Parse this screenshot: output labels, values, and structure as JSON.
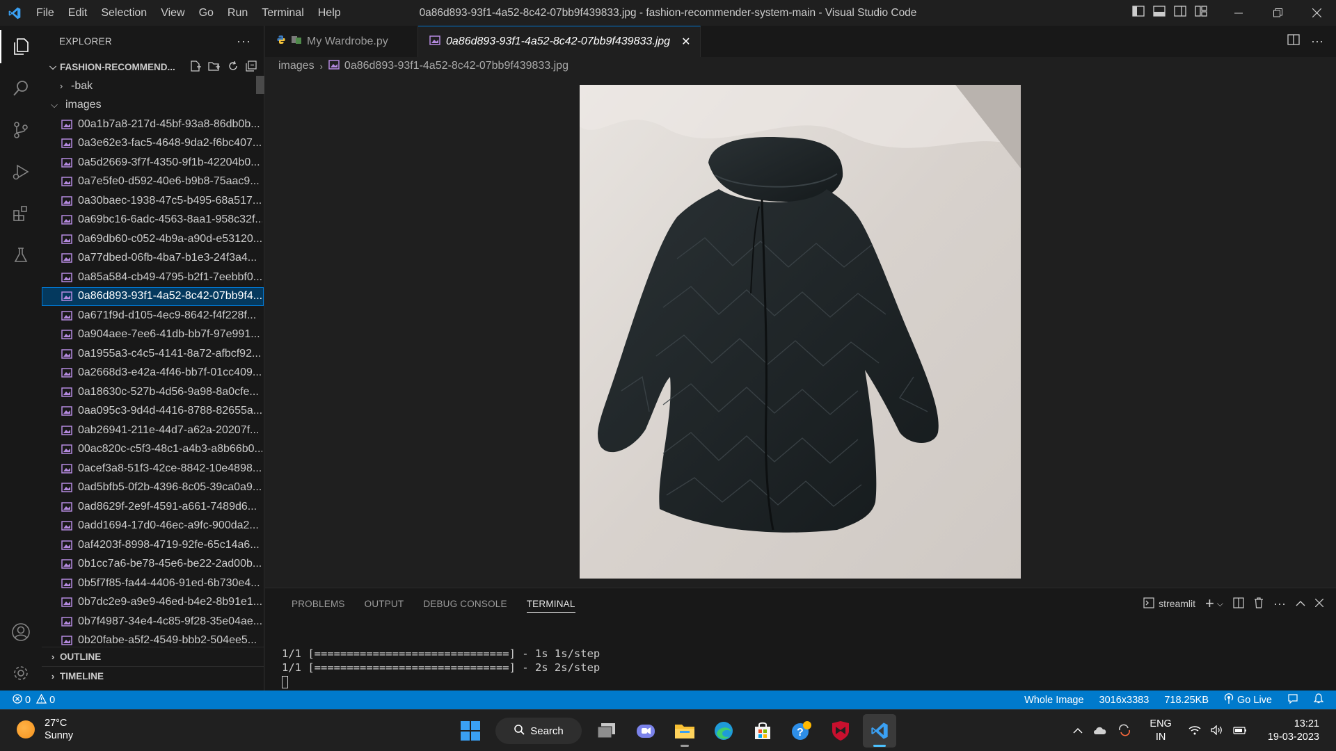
{
  "titlebar": {
    "menu": [
      "File",
      "Edit",
      "Selection",
      "View",
      "Go",
      "Run",
      "Terminal",
      "Help"
    ],
    "window_title": "0a86d893-93f1-4a52-8c42-07bb9f439833.jpg - fashion-recommender-system-main - Visual Studio Code"
  },
  "sidebar": {
    "title": "EXPLORER",
    "more": "···",
    "folder": "FASHION-RECOMMEND...",
    "tree": {
      "bak": "-bak",
      "images": "images"
    },
    "files": [
      "00a1b7a8-217d-45bf-93a8-86db0b...",
      "0a3e62e3-fac5-4648-9da2-f6bc407...",
      "0a5d2669-3f7f-4350-9f1b-42204b0...",
      "0a7e5fe0-d592-40e6-b9b8-75aac9...",
      "0a30baec-1938-47c5-b495-68a517...",
      "0a69bc16-6adc-4563-8aa1-958c32f...",
      "0a69db60-c052-4b9a-a90d-e53120...",
      "0a77dbed-06fb-4ba7-b1e3-24f3a4...",
      "0a85a584-cb49-4795-b2f1-7eebbf0...",
      "0a86d893-93f1-4a52-8c42-07bb9f4...",
      "0a671f9d-d105-4ec9-8642-f4f228f...",
      "0a904aee-7ee6-41db-bb7f-97e991...",
      "0a1955a3-c4c5-4141-8a72-afbcf92...",
      "0a2668d3-e42a-4f46-bb7f-01cc409...",
      "0a18630c-527b-4d56-9a98-8a0cfe...",
      "0aa095c3-9d4d-4416-8788-82655a...",
      "0ab26941-211e-44d7-a62a-20207f...",
      "00ac820c-c5f3-48c1-a4b3-a8b66b0...",
      "0acef3a8-51f3-42ce-8842-10e4898...",
      "0ad5bfb5-0f2b-4396-8c05-39ca0a9...",
      "0ad8629f-2e9f-4591-a661-7489d6...",
      "0add1694-17d0-46ec-a9fc-900da2...",
      "0af4203f-8998-4719-92fe-65c14a6...",
      "0b1cc7a6-be78-45e6-be22-2ad00b...",
      "0b5f7f85-fa44-4406-91ed-6b730e4...",
      "0b7dc2e9-a9e9-46ed-b4e2-8b91e1...",
      "0b7f4987-34e4-4c85-9f28-35e04ae...",
      "0b20fabe-a5f2-4549-bbb2-504ee5..."
    ],
    "selected_index": 9,
    "outline": "OUTLINE",
    "timeline": "TIMELINE"
  },
  "tabs": [
    {
      "label": "My Wardrobe.py",
      "icon": "python-icon"
    },
    {
      "label": "0a86d893-93f1-4a52-8c42-07bb9f439833.jpg",
      "icon": "image-icon",
      "close": "✕"
    }
  ],
  "breadcrumb": {
    "folder": "images",
    "file": "0a86d893-93f1-4a52-8c42-07bb9f439833.jpg"
  },
  "panel": {
    "tabs": [
      "PROBLEMS",
      "OUTPUT",
      "DEBUG CONSOLE",
      "TERMINAL"
    ],
    "active_tab": "TERMINAL",
    "terminal_name": "streamlit",
    "lines": [
      "1/1 [==============================] - 1s 1s/step",
      "1/1 [==============================] - 2s 2s/step"
    ]
  },
  "statusbar": {
    "errors": "0",
    "warnings": "0",
    "view": "Whole Image",
    "dimensions": "3016x3383",
    "size": "718.25KB",
    "golive": "Go Live"
  },
  "taskbar": {
    "temp": "27°C",
    "condition": "Sunny",
    "search": "Search",
    "lang1": "ENG",
    "lang2": "IN",
    "time": "13:21",
    "date": "19-03-2023"
  },
  "colors": {
    "accent": "#0078d4",
    "statusbar": "#007acc",
    "selection": "#04395e"
  }
}
